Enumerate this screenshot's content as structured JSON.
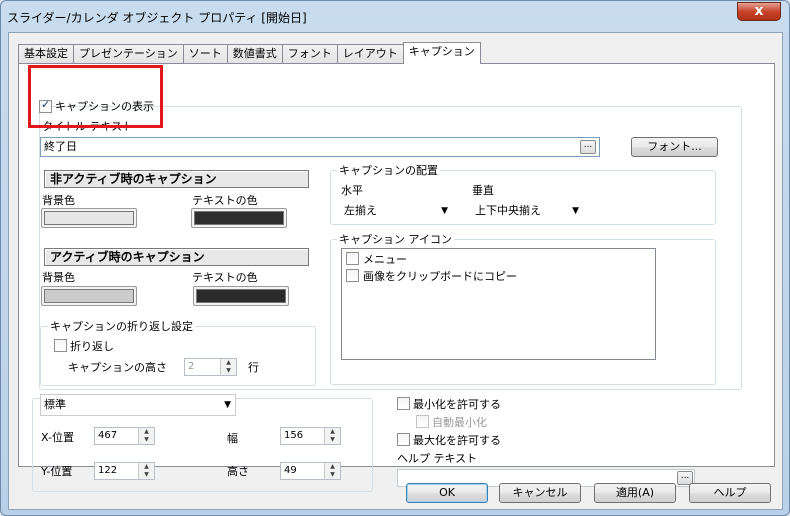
{
  "window": {
    "title": "スライダー/カレンダ オブジェクト プロパティ [開始日]",
    "close_label": "x"
  },
  "tabs": [
    "基本設定",
    "プレゼンテーション",
    "ソート",
    "数値書式",
    "フォント",
    "レイアウト",
    "キャプション"
  ],
  "active_tab": "キャプション",
  "caption": {
    "show_caption_label": "キャプションの表示",
    "show_caption_checked": true,
    "title_text_label": "タイトル テキスト",
    "title_text_value": "終了日",
    "ellipsis": "...",
    "font_button": "フォント..."
  },
  "inactive": {
    "header": "非アクティブ時のキャプション",
    "bg_label": "背景色",
    "text_label": "テキストの色",
    "bg_color": "#e6e6e6",
    "text_color": "#2e2e2e"
  },
  "active": {
    "header": "アクティブ時のキャプション",
    "bg_label": "背景色",
    "text_label": "テキストの色",
    "bg_color": "#cccccc",
    "text_color": "#2a2a2a"
  },
  "wrap": {
    "group_label": "キャプションの折り返し設定",
    "wrap_label": "折り返し",
    "wrap_checked": false,
    "height_label": "キャプションの高さ",
    "height_value": "2",
    "unit_label": "行"
  },
  "alignment": {
    "group_label": "キャプションの配置",
    "horizontal_label": "水平",
    "vertical_label": "垂直",
    "horizontal_value": "左揃え",
    "vertical_value": "上下中央揃え"
  },
  "icons": {
    "group_label": "キャプション アイコン",
    "items": [
      "メニュー",
      "画像をクリップボードにコピー"
    ]
  },
  "position": {
    "mode_value": "標準",
    "x_label": "X-位置",
    "x_value": "467",
    "y_label": "Y-位置",
    "y_value": "122",
    "width_label": "幅",
    "width_value": "156",
    "height_label": "高さ",
    "height_value": "49"
  },
  "options": {
    "allow_minimize": "最小化を許可する",
    "auto_minimize": "自動最小化",
    "allow_maximize": "最大化を許可する",
    "help_text_label": "ヘルプ テキスト"
  },
  "buttons": {
    "ok": "OK",
    "cancel": "キャンセル",
    "apply": "適用(A)",
    "help": "ヘルプ"
  },
  "colors": {
    "highlight_box": "#e3161e"
  }
}
